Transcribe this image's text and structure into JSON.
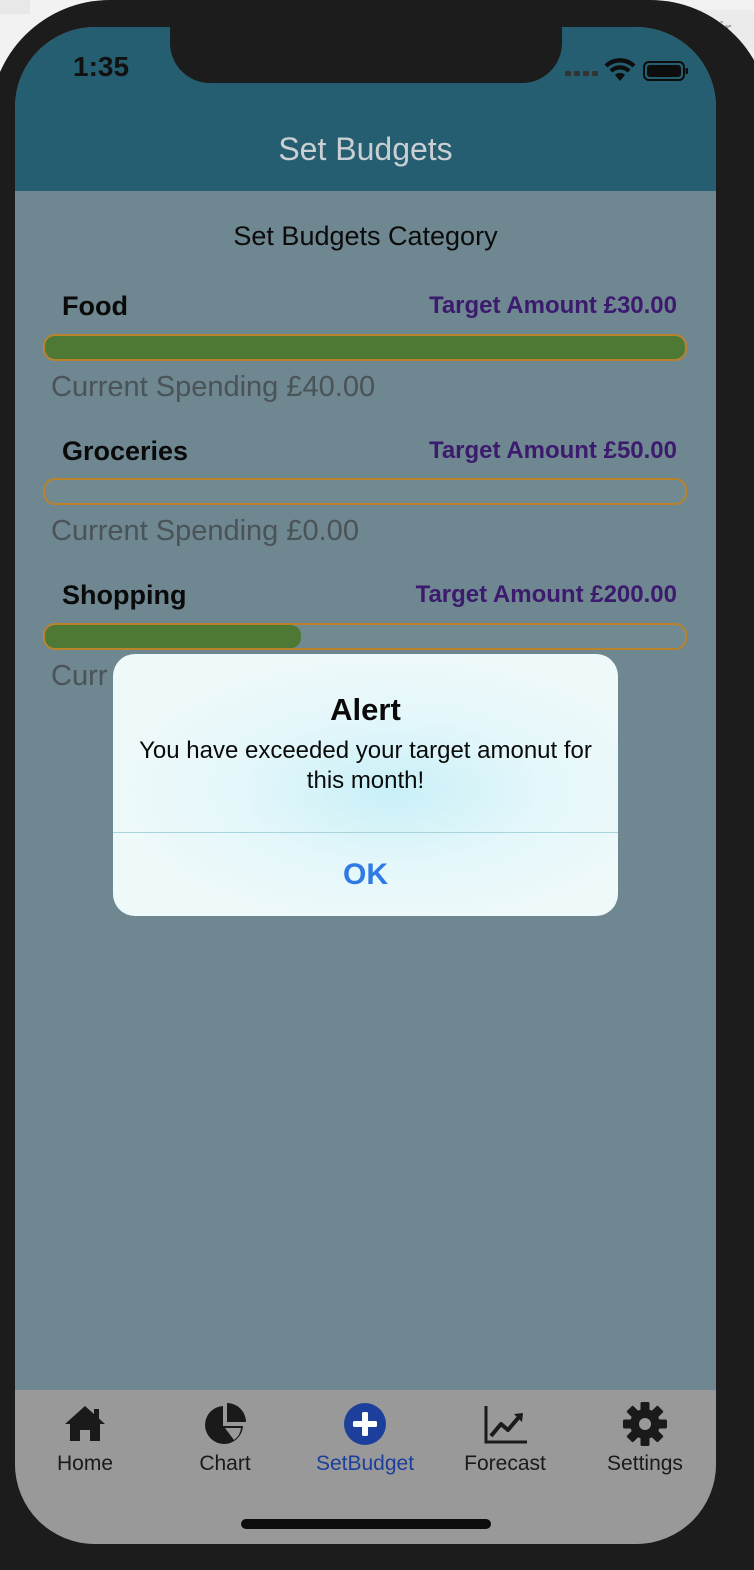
{
  "status_bar": {
    "time": "1:35"
  },
  "background_window": {
    "partial_text": "nir"
  },
  "header": {
    "title": "Set Budgets"
  },
  "content": {
    "title": "Set Budgets Category",
    "categories": [
      {
        "name": "Food",
        "target": "Target Amount £30.00",
        "spending": "Current Spending £40.00",
        "progress_fraction": 1.0
      },
      {
        "name": "Groceries",
        "target": "Target Amount £50.00",
        "spending": "Current Spending £0.00",
        "progress_fraction": 0.0
      },
      {
        "name": "Shopping",
        "target": "Target Amount £200.00",
        "spending": "Curr",
        "progress_fraction": 0.4
      }
    ]
  },
  "alert": {
    "title": "Alert",
    "message": "You have exceeded your target amonut for this month!",
    "ok_label": "OK"
  },
  "tabbar": {
    "items": [
      {
        "label": "Home",
        "icon": "home-icon",
        "active": false
      },
      {
        "label": "Chart",
        "icon": "pie-chart-icon",
        "active": false
      },
      {
        "label": "SetBudget",
        "icon": "plus-circle-icon",
        "active": true
      },
      {
        "label": "Forecast",
        "icon": "line-chart-icon",
        "active": false
      },
      {
        "label": "Settings",
        "icon": "gear-icon",
        "active": false
      }
    ]
  },
  "colors": {
    "header_bg": "#255e70",
    "content_bg": "#6e8790",
    "progress_fill": "#4e7934",
    "progress_border": "#b9822b",
    "target_text": "#3c1a6e",
    "alert_ok": "#2f7ae5",
    "tab_active": "#1c3f9c"
  }
}
